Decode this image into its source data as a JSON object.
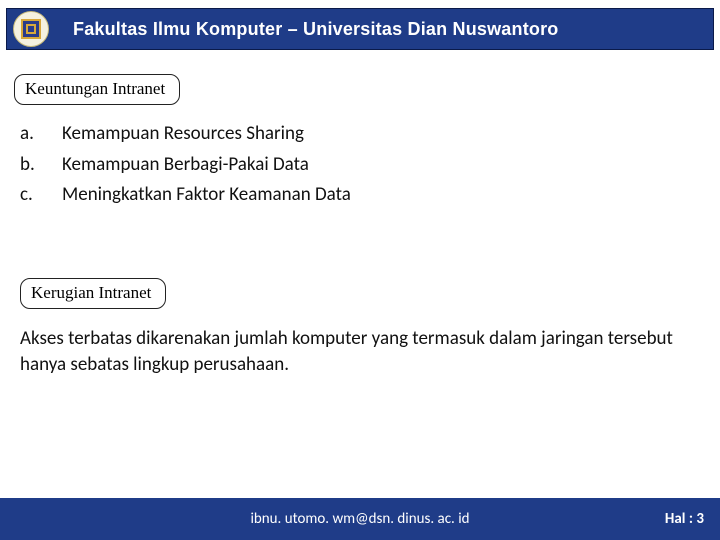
{
  "header": {
    "title": "Fakultas Ilmu Komputer – Universitas Dian Nuswantoro"
  },
  "sections": {
    "advantages_label": "Keuntungan Intranet",
    "disadvantages_label": "Kerugian Intranet"
  },
  "list": {
    "items": [
      {
        "marker": "a.",
        "text": "Kemampuan Resources Sharing"
      },
      {
        "marker": "b.",
        "text": "Kemampuan Berbagi-Pakai Data"
      },
      {
        "marker": "c.",
        "text": "Meningkatkan Faktor Keamanan Data"
      }
    ]
  },
  "paragraph": "Akses terbatas dikarenakan jumlah komputer yang termasuk dalam jaringan  tersebut hanya sebatas lingkup perusahaan.",
  "footer": {
    "email": "ibnu. utomo. wm@dsn. dinus. ac. id",
    "page": "Hal : 3"
  },
  "colors": {
    "primary": "#1f3c88"
  }
}
